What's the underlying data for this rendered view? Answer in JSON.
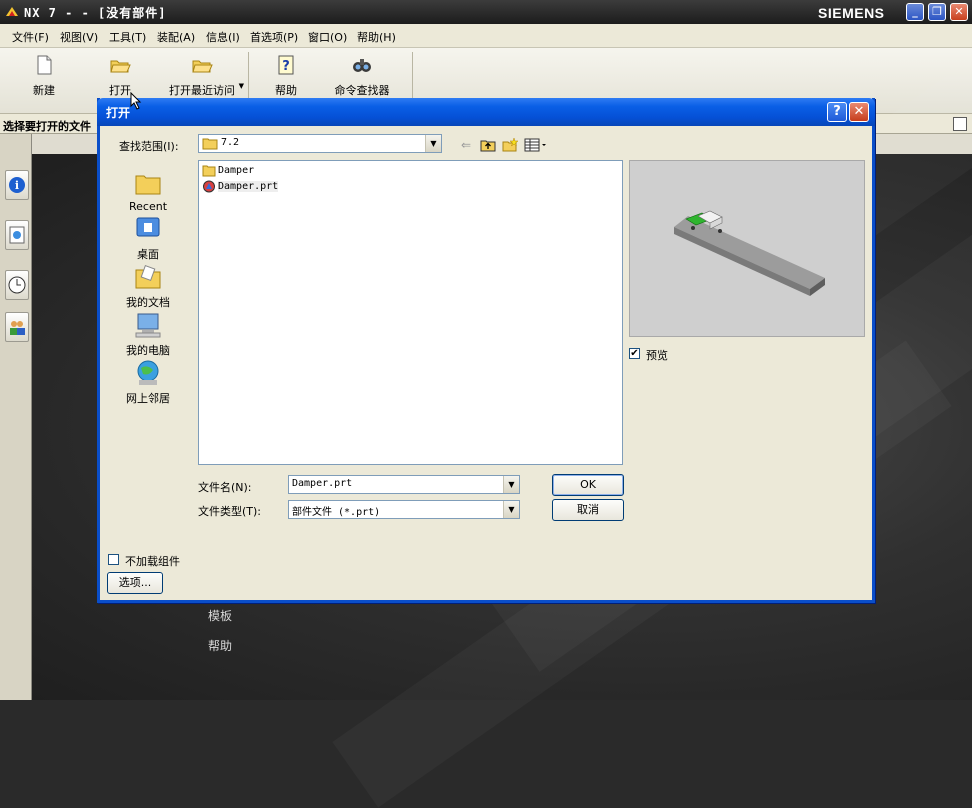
{
  "app": {
    "title": "NX 7 - - [没有部件]",
    "brand": "SIEMENS"
  },
  "menu": [
    "文件(F)",
    "视图(V)",
    "工具(T)",
    "装配(A)",
    "信息(I)",
    "首选项(P)",
    "窗口(O)",
    "帮助(H)"
  ],
  "toolbar": {
    "new": "新建",
    "open": "打开",
    "open_recent": "打开最近访问",
    "help": "帮助",
    "command_finder": "命令查找器"
  },
  "cue_line": "选择要打开的文件",
  "left_links": [
    "模板",
    "帮助"
  ],
  "dialog": {
    "title": "打开",
    "look_in_label": "查找范围(I):",
    "look_in_value": "7.2",
    "places": [
      "Recent",
      "桌面",
      "我的文档",
      "我的电脑",
      "网上邻居"
    ],
    "files": [
      {
        "name": "Damper",
        "type": "folder"
      },
      {
        "name": "Damper.prt",
        "type": "part",
        "selected": true
      }
    ],
    "preview_label": "预览",
    "preview_checked": true,
    "file_name_label": "文件名(N):",
    "file_name_value": "Damper.prt",
    "file_type_label": "文件类型(T):",
    "file_type_value": "部件文件 (*.prt)",
    "ok": "OK",
    "cancel": "取消",
    "no_load_components": "不加载组件",
    "no_load_checked": false,
    "options": "选项..."
  }
}
